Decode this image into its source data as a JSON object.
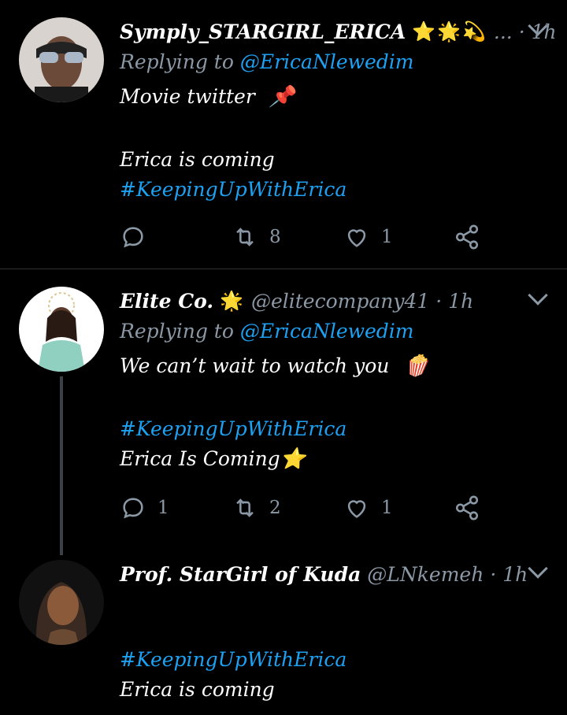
{
  "tweets": [
    {
      "name": "Symply_STARGIRL_ERICA",
      "name_emoji": "⭐🌟💫",
      "handle": "",
      "ellipsis": "...",
      "time": "· 1h",
      "replying_prefix": "Replying to",
      "replying_handle": "@EricaNlewedim",
      "text_line1": "Movie twitter",
      "text_line1_emoji": "📌",
      "text_line2": "Erica is coming",
      "hashtag": "#KeepingUpWithErica",
      "replies": "",
      "retweets": "8",
      "likes": "1"
    },
    {
      "name": "Elite Co.",
      "name_emoji": "🌟",
      "handle": "@elitecompany41",
      "time": "· 1h",
      "replying_prefix": "Replying to",
      "replying_handle": "@EricaNlewedim",
      "text_line1": "We can’t wait to watch you",
      "text_line1_emoji": "🍿",
      "hashtag": "#KeepingUpWithErica",
      "text_line3": "Erica Is Coming",
      "text_line3_emoji": "⭐",
      "replies": "1",
      "retweets": "2",
      "likes": "1"
    },
    {
      "name": "Prof. StarGirl of Kuda",
      "handle": "@LNkemeh",
      "time": "· 1h",
      "hashtag": "#KeepingUpWithErica",
      "text_line2": "Erica is coming"
    }
  ],
  "colors": {
    "background": "#000000",
    "muted": "#8b98a5",
    "link": "#1da1f2",
    "star": "#f5a623"
  },
  "icons": [
    "reply-icon",
    "retweet-icon",
    "like-icon",
    "share-icon",
    "chevron-down-icon"
  ]
}
